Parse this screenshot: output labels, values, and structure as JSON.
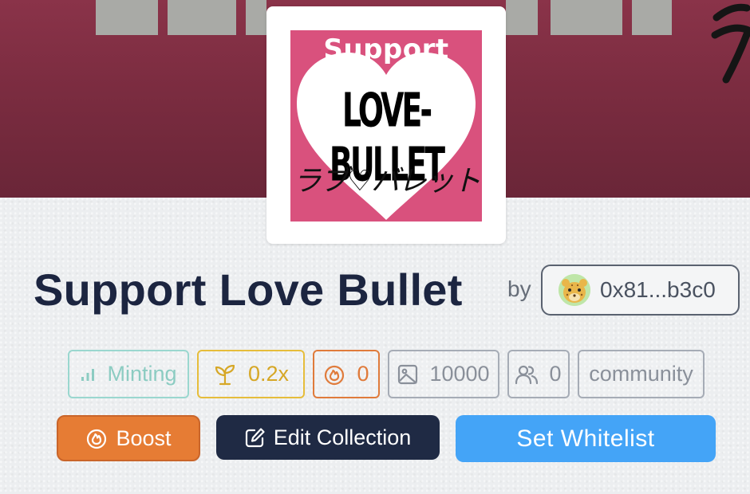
{
  "collection": {
    "title": "Support Love Bullet",
    "by_label": "by",
    "owner_address": "0x81...b3c0"
  },
  "avatar_art": {
    "top_text": "Support",
    "main_text": "LOVE-BULLET",
    "sub_text": "ラブ♡バレット"
  },
  "badges": {
    "status": "Minting",
    "rate": "0.2x",
    "boost_count": "0",
    "supply": "10000",
    "holders": "0",
    "category": "community"
  },
  "actions": {
    "boost_label": "Boost",
    "edit_label": "Edit Collection",
    "whitelist_label": "Set Whitelist"
  },
  "colors": {
    "banner": "#7b2c40",
    "boost": "#e67c34",
    "edit": "#1f2a44",
    "whitelist": "#44a4f7",
    "minting": "#8cccc2",
    "rate": "#d6a726"
  }
}
